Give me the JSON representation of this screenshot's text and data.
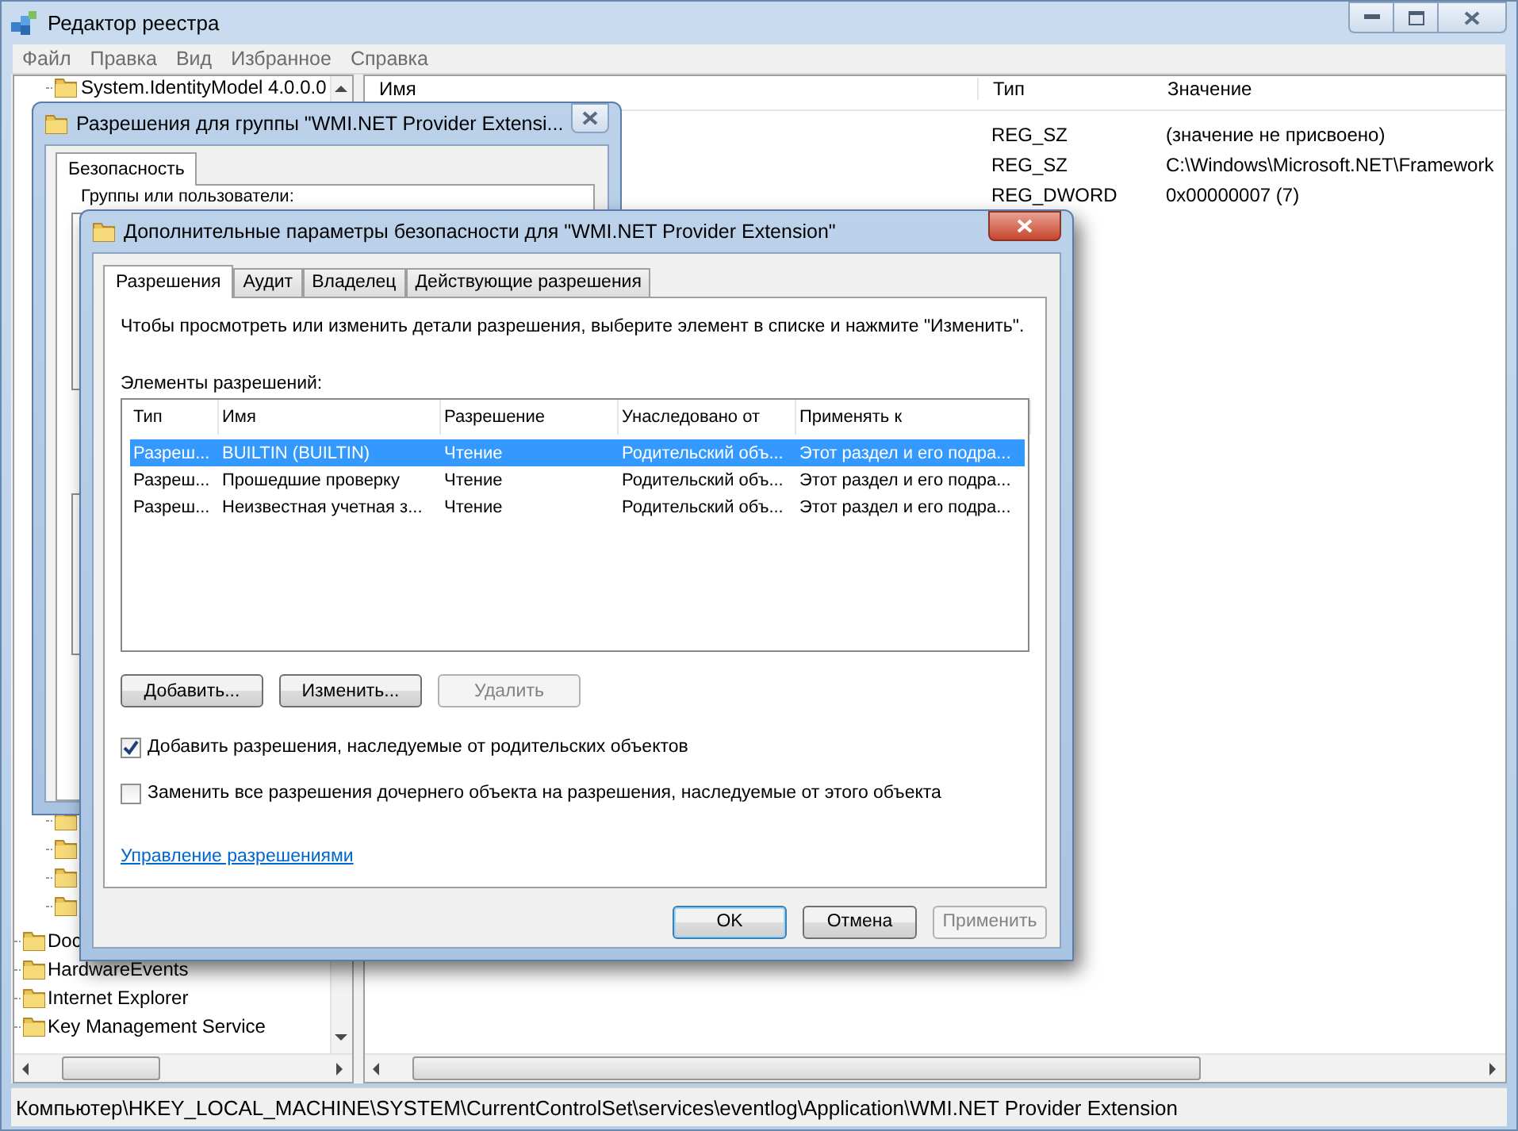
{
  "registry_editor": {
    "title": "Редактор реестра",
    "menu": [
      "Файл",
      "Правка",
      "Вид",
      "Избранное",
      "Справка"
    ],
    "tree": [
      {
        "children": [
          {
            "kind": "folder",
            "label": "System.IdentityModel 4.0.0.0"
          },
          {
            "kind": "folder-stub"
          },
          {
            "kind": "folder-stub"
          },
          {
            "kind": "folder-stub"
          },
          {
            "kind": "folder-stub"
          }
        ]
      },
      {
        "kind": "folder",
        "label": "Doc"
      },
      {
        "kind": "folder",
        "label": "HardwareEvents"
      },
      {
        "kind": "folder",
        "label": "Internet Explorer"
      },
      {
        "kind": "folder",
        "label": "Key Management Service"
      }
    ],
    "columns": [
      "Имя",
      "Тип",
      "Значение"
    ],
    "rows": [
      {
        "type": "REG_SZ",
        "value": "(значение не присвоено)"
      },
      {
        "type": "REG_SZ",
        "value": "C:\\Windows\\Microsoft.NET\\Framework"
      },
      {
        "type": "REG_DWORD",
        "value": "0x00000007 (7)"
      }
    ],
    "status_bar": "Компьютер\\HKEY_LOCAL_MACHINE\\SYSTEM\\CurrentControlSet\\services\\eventlog\\Application\\WMI.NET Provider Extension"
  },
  "group_permissions_dialog": {
    "title": "Разрешения для группы \"WMI.NET Provider Extensi...",
    "tabs": [
      {
        "label": "Безопасность",
        "selected": true
      }
    ],
    "groups_label": "Группы или пользователи:"
  },
  "advanced_security_dialog": {
    "title": "Дополнительные параметры безопасности  для \"WMI.NET Provider Extension\"",
    "tabs": [
      {
        "label": "Разрешения",
        "selected": true
      },
      {
        "label": "Аудит",
        "selected": false
      },
      {
        "label": "Владелец",
        "selected": false
      },
      {
        "label": "Действующие разрешения",
        "selected": false
      }
    ],
    "hint": "Чтобы просмотреть или изменить детали разрешения, выберите элемент в списке и нажмите \"Изменить\".",
    "list_label": "Элементы разрешений:",
    "columns": [
      "Тип",
      "Имя",
      "Разрешение",
      "Унаследовано от",
      "Применять к"
    ],
    "rows": [
      {
        "selected": true,
        "cells": [
          "Разреш...",
          "BUILTIN (BUILTIN)",
          "Чтение",
          "Родительский объ...",
          "Этот раздел и его подра..."
        ]
      },
      {
        "selected": false,
        "cells": [
          "Разреш...",
          "Прошедшие проверку",
          "Чтение",
          "Родительский объ...",
          "Этот раздел и его подра..."
        ]
      },
      {
        "selected": false,
        "cells": [
          "Разреш...",
          "Неизвестная учетная з...",
          "Чтение",
          "Родительский объ...",
          "Этот раздел и его подра..."
        ]
      }
    ],
    "list_buttons": [
      {
        "label": "Добавить...",
        "disabled": false
      },
      {
        "label": "Изменить...",
        "disabled": false
      },
      {
        "label": "Удалить",
        "disabled": true
      }
    ],
    "checkboxes": [
      {
        "label": "Добавить разрешения, наследуемые от родительских объектов",
        "checked": true
      },
      {
        "label": "Заменить все разрешения дочернего объекта на разрешения, наследуемые от этого объекта",
        "checked": false
      }
    ],
    "link": "Управление разрешениями",
    "buttons": [
      {
        "label": "OK",
        "disabled": false,
        "default": true
      },
      {
        "label": "Отмена",
        "disabled": false,
        "default": false
      },
      {
        "label": "Применить",
        "disabled": true,
        "default": false
      }
    ]
  }
}
